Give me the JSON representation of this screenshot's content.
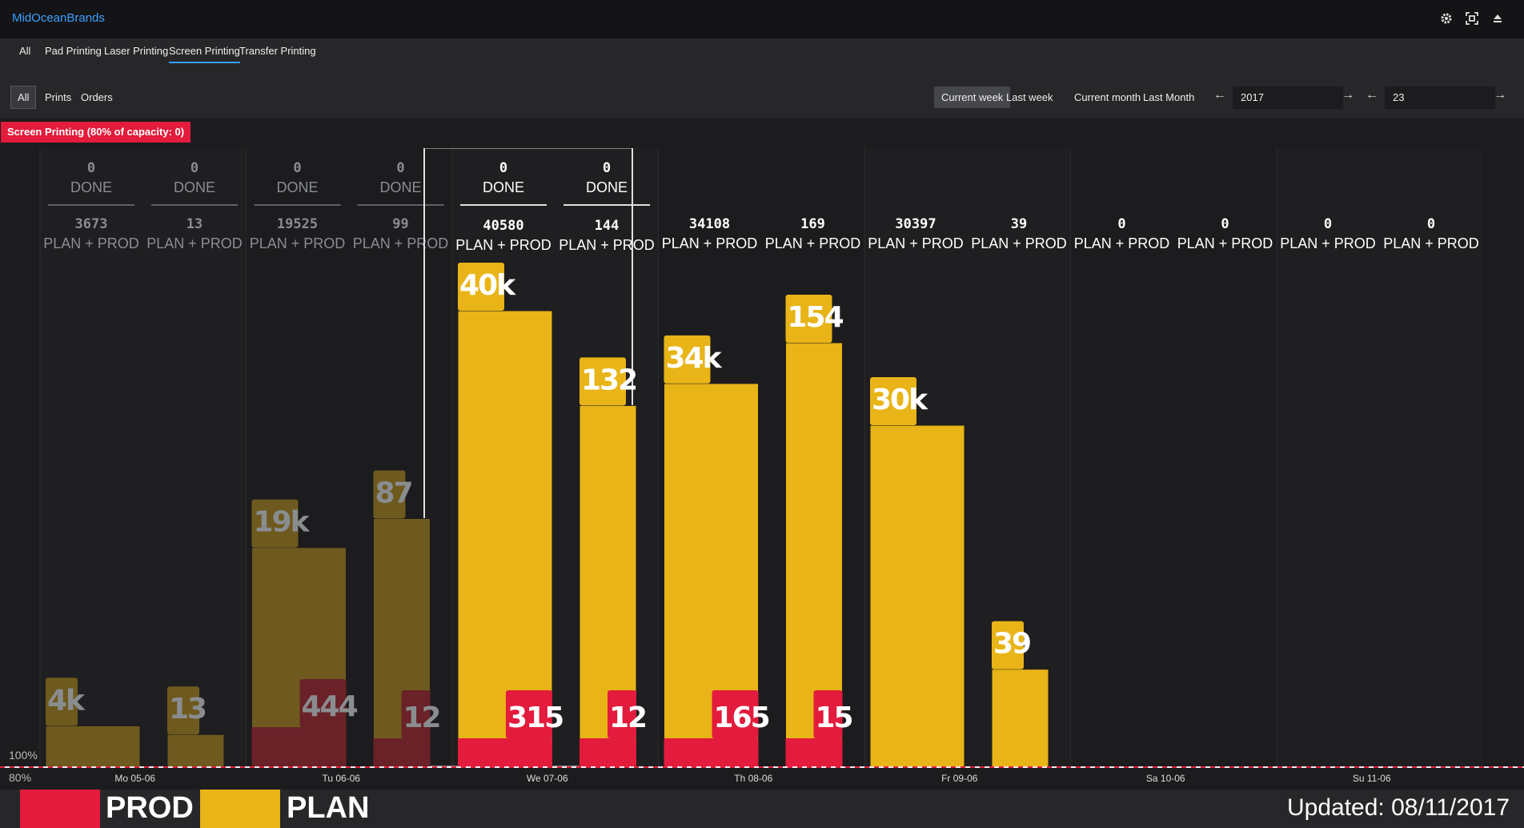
{
  "app": {
    "brand": "MidOceanBrands"
  },
  "toolbar_icons": [
    "gear-icon",
    "fullscreen-icon",
    "eject-icon"
  ],
  "tabs": [
    {
      "label": "All",
      "active": false
    },
    {
      "label": "Pad Printing",
      "active": false
    },
    {
      "label": "Laser Printing",
      "active": false
    },
    {
      "label": "Screen Printing",
      "active": true
    },
    {
      "label": "Transfer Printing",
      "active": false
    }
  ],
  "filters": {
    "left": [
      {
        "label": "All",
        "active": true
      },
      {
        "label": "Prints",
        "active": false
      },
      {
        "label": "Orders",
        "active": false
      }
    ],
    "ranges": [
      {
        "label": "Current week",
        "active": true
      },
      {
        "label": "Last week",
        "active": false
      },
      {
        "label": "Current month",
        "active": false
      },
      {
        "label": "Last Month",
        "active": false
      }
    ],
    "year": "2017",
    "week": "23"
  },
  "capacity_badge": "Screen Printing (80% of capacity: 0)",
  "chart_data": {
    "type": "bar",
    "reference_lines": [
      {
        "label": "100%"
      },
      {
        "label": "80%"
      }
    ],
    "legend": [
      {
        "name": "PROD",
        "color": "#e31b3c"
      },
      {
        "name": "PLAN",
        "color": "#e8b417"
      }
    ],
    "done_label": "DONE",
    "plan_label": "PLAN + PROD",
    "days": [
      {
        "label": "Mo 05-06",
        "state": "past",
        "bars": [
          {
            "done": "0",
            "plan_prod": "3673",
            "plan": 3673,
            "plan_label": "4k",
            "prod": 0,
            "prod_label": ""
          },
          {
            "done": "0",
            "plan_prod": "13",
            "plan": 13,
            "plan_label": "13",
            "prod": 0,
            "prod_label": ""
          }
        ]
      },
      {
        "label": "Tu 06-06",
        "state": "past",
        "bars": [
          {
            "done": "0",
            "plan_prod": "19525",
            "plan": 19525,
            "plan_label": "19k",
            "prod": 444,
            "prod_label": "444"
          },
          {
            "done": "0",
            "plan_prod": "99",
            "plan": 99,
            "plan_label": "87",
            "prod": 12,
            "prod_label": "12"
          }
        ]
      },
      {
        "label": "We 07-06",
        "state": "today",
        "bars": [
          {
            "done": "0",
            "plan_prod": "40580",
            "plan": 40580,
            "plan_label": "40k",
            "prod": 315,
            "prod_label": "315"
          },
          {
            "done": "0",
            "plan_prod": "144",
            "plan": 144,
            "plan_label": "132",
            "prod": 12,
            "prod_label": "12"
          }
        ]
      },
      {
        "label": "Th 08-06",
        "state": "future",
        "bars": [
          {
            "done": "",
            "plan_prod": "34108",
            "plan": 34108,
            "plan_label": "34k",
            "prod": 165,
            "prod_label": "165"
          },
          {
            "done": "",
            "plan_prod": "169",
            "plan": 169,
            "plan_label": "154",
            "prod": 15,
            "prod_label": "15"
          }
        ]
      },
      {
        "label": "Fr 09-06",
        "state": "future",
        "bars": [
          {
            "done": "",
            "plan_prod": "30397",
            "plan": 30397,
            "plan_label": "30k",
            "prod": 0,
            "prod_label": ""
          },
          {
            "done": "",
            "plan_prod": "39",
            "plan": 39,
            "plan_label": "39",
            "prod": 0,
            "prod_label": ""
          }
        ]
      },
      {
        "label": "Sa 10-06",
        "state": "future",
        "bars": [
          {
            "done": "",
            "plan_prod": "0",
            "plan": 0,
            "plan_label": "",
            "prod": 0,
            "prod_label": ""
          },
          {
            "done": "",
            "plan_prod": "0",
            "plan": 0,
            "plan_label": "",
            "prod": 0,
            "prod_label": ""
          }
        ]
      },
      {
        "label": "Su 11-06",
        "state": "future",
        "bars": [
          {
            "done": "",
            "plan_prod": "0",
            "plan": 0,
            "plan_label": "",
            "prod": 0,
            "prod_label": ""
          },
          {
            "done": "",
            "plan_prod": "0",
            "plan": 0,
            "plan_label": "",
            "prod": 0,
            "prod_label": ""
          }
        ]
      }
    ]
  },
  "footer": {
    "prod_label": "PROD",
    "plan_label": "PLAN",
    "updated": "Updated: 08/11/2017"
  }
}
